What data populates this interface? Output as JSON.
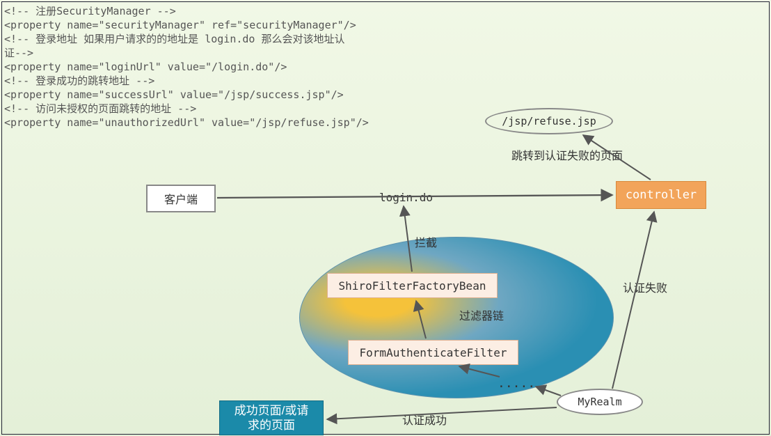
{
  "code_block": "<!-- 注册SecurityManager -->\n<property name=\"securityManager\" ref=\"securityManager\"/>\n<!-- 登录地址 如果用户请求的的地址是 login.do 那么会对该地址认\n证-->\n<property name=\"loginUrl\" value=\"/login.do\"/>\n<!-- 登录成功的跳转地址 -->\n<property name=\"successUrl\" value=\"/jsp/success.jsp\"/>\n<!-- 访问未授权的页面跳转的地址 -->\n<property name=\"unauthorizedUrl\" value=\"/jsp/refuse.jsp\"/>",
  "nodes": {
    "client": "客户端",
    "controller": "controller",
    "refuse_ellipse": "/jsp/refuse.jsp",
    "shiro_factory": "ShiroFilterFactoryBean",
    "form_auth": "FormAuthenticateFilter",
    "dots": ".....",
    "myrealm": "MyRealm",
    "success_box": "成功页面/或请\n求的页面"
  },
  "labels": {
    "login_do": "login.do",
    "intercept": "拦截",
    "filter_chain": "过滤器链",
    "auth_fail": "认证失败",
    "auth_success": "认证成功",
    "to_fail_page": "跳转到认证失败的页面"
  }
}
